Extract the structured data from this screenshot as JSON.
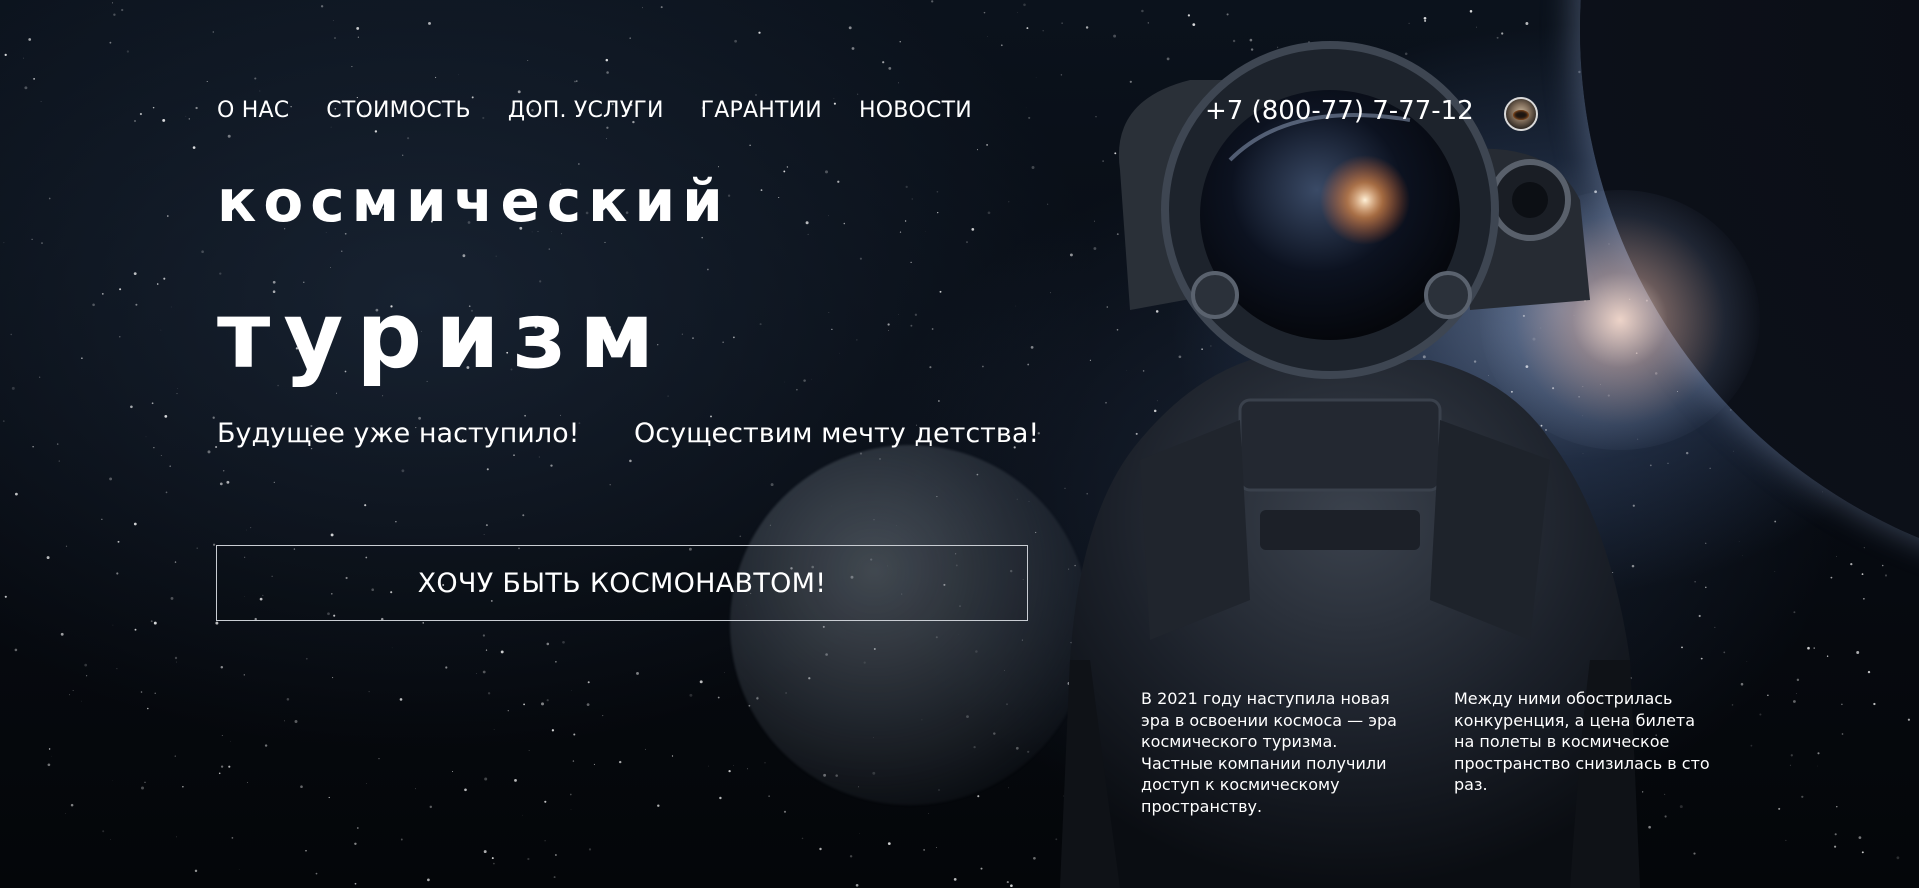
{
  "nav": {
    "items": [
      "О НАС",
      "СТОИМОСТЬ",
      "ДОП. УСЛУГИ",
      "ГАРАНТИИ",
      "НОВОСТИ"
    ]
  },
  "header": {
    "phone": "+7 (800-77) 7-77-12",
    "avatar_icon": "astronaut-helmet-icon"
  },
  "hero": {
    "title_line1": "космический",
    "title_line2": "туризм",
    "tagline_left": "Будущее уже наступило!",
    "tagline_right": "Осуществим мечту детства!",
    "cta_label": "ХОЧУ БЫТЬ КОСМОНАВТОМ!",
    "paragraph_left": "В 2021 году наступила новая эра в освоении космоса — эра космического туризма. Частные компании получили доступ к космическому пространству.",
    "paragraph_right": "Между ними обострилась конкуренция, а цена билета на полеты в космическое пространство снизилась в сто раз."
  },
  "colors": {
    "background": "#05070b",
    "text": "#ffffff",
    "button_border": "#c9cdd3"
  }
}
